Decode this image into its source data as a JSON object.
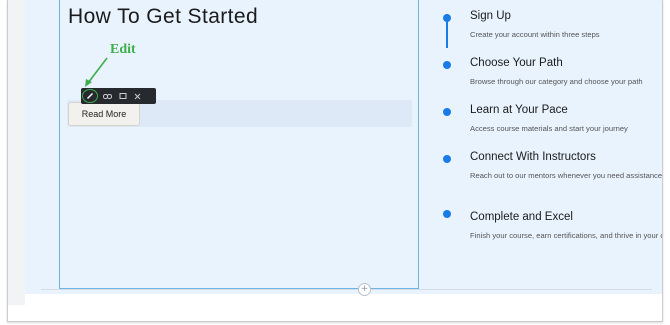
{
  "page": {
    "heading": "How To Get Started",
    "annotation_label": "Edit",
    "read_more_label": "Read More",
    "add_icon": "+"
  },
  "toolbar": {
    "icons": [
      "edit-icon",
      "link-icon",
      "duplicate-icon",
      "close-icon"
    ]
  },
  "steps": [
    {
      "title": "Sign Up",
      "desc": "Create your account within three steps"
    },
    {
      "title": "Choose Your Path",
      "desc": "Browse through our category and choose your path"
    },
    {
      "title": "Learn at Your Pace",
      "desc": "Access course materials and start your journey"
    },
    {
      "title": "Connect With Instructors",
      "desc": "Reach out to our mentors whenever you need assistance"
    },
    {
      "title": "Complete and Excel",
      "desc": "Finish your course, earn certifications, and thrive in your career"
    }
  ],
  "colors": {
    "accent": "#1a7be6",
    "annotation": "#3fad4b",
    "canvas": "#e8f3fe",
    "column_border": "#6fb3e2"
  }
}
